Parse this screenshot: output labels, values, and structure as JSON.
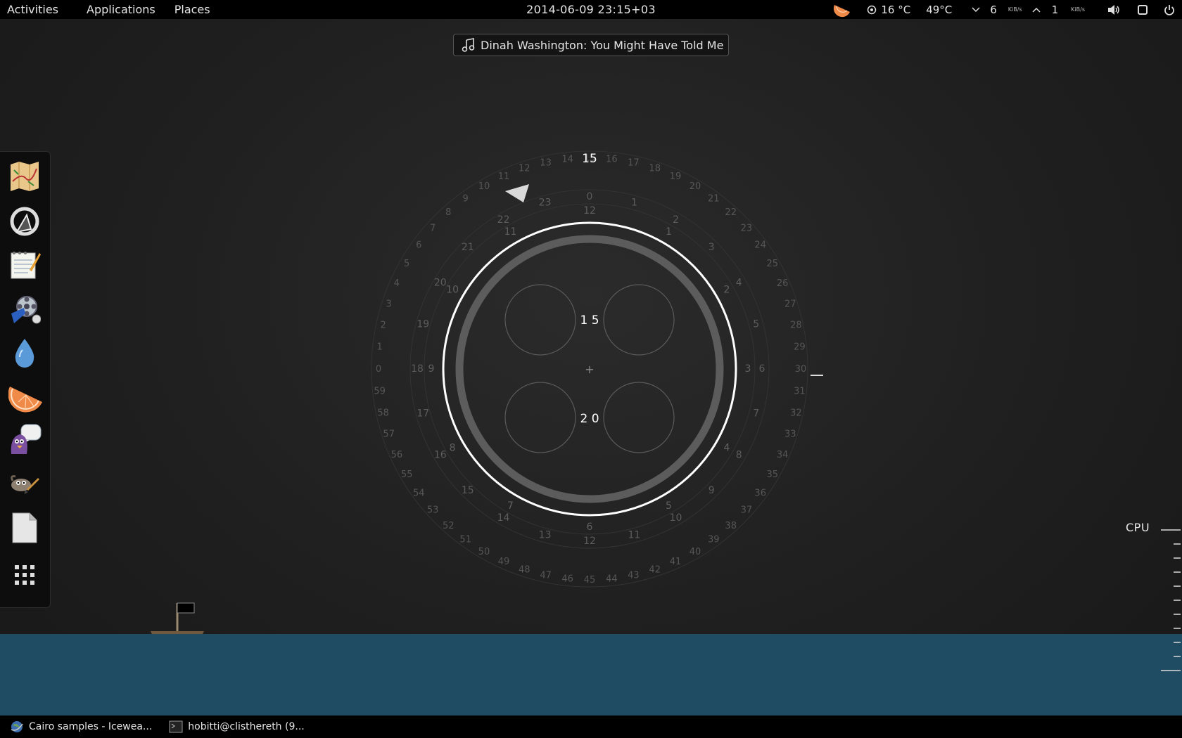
{
  "topbar": {
    "activities": "Activities",
    "applications": "Applications",
    "places": "Places",
    "datetime": "2014-06-09 23:15+03",
    "weather_temp": "16 °C",
    "cpu_temp": "49°C",
    "download_value": "6",
    "download_unit": "KiB/s",
    "upload_value": "1",
    "upload_unit": "KiB/s"
  },
  "now_playing": {
    "text": "Dinah Washington: You Might Have Told Me"
  },
  "dock": {
    "apps": [
      {
        "name": "maps-icon"
      },
      {
        "name": "tweak-icon"
      },
      {
        "name": "text-editor-icon"
      },
      {
        "name": "video-player-icon"
      },
      {
        "name": "drop-icon"
      },
      {
        "name": "orange-icon"
      },
      {
        "name": "chat-icon"
      },
      {
        "name": "gimp-icon"
      },
      {
        "name": "document-icon"
      },
      {
        "name": "app-grid-icon"
      }
    ]
  },
  "clock_widget": {
    "hour_display": "1 5",
    "minute_display": "2 0",
    "top_number": "15"
  },
  "cpu": {
    "label": "CPU"
  },
  "taskbar": {
    "tasks": [
      {
        "label": "Cairo samples - Icewea..."
      },
      {
        "label": "hobitti@clisthereth (9..."
      }
    ]
  },
  "colors": {
    "sea": "#1f4b63",
    "bar": "#000000"
  }
}
